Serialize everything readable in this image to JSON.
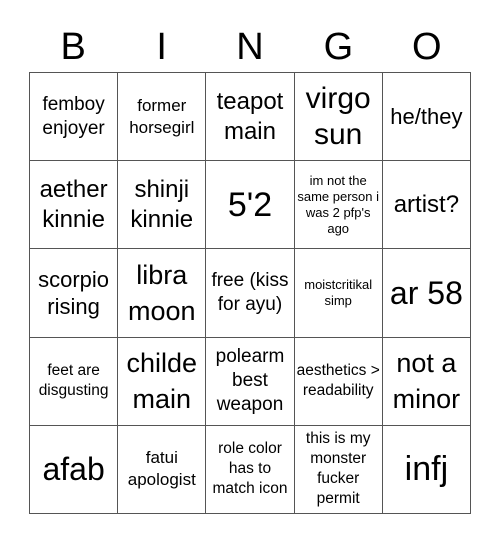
{
  "header": {
    "letters": [
      "B",
      "I",
      "N",
      "G",
      "O"
    ]
  },
  "cells": [
    "femboy enjoyer",
    "former horsegirl",
    "teapot main",
    "virgo sun",
    "he/they",
    "aether kinnie",
    "shinji kinnie",
    "5'2",
    "im not the same person i was 2 pfp's ago",
    "artist?",
    "scorpio rising",
    "libra moon",
    "free (kiss for ayu)",
    "moistcritikal simp",
    "ar 58",
    "feet are disgusting",
    "childe main",
    "polearm best weapon",
    "aesthetics > readability",
    "not a minor",
    "afab",
    "fatui apologist",
    "role color has to match icon",
    "this is my monster fucker permit",
    "infj"
  ]
}
